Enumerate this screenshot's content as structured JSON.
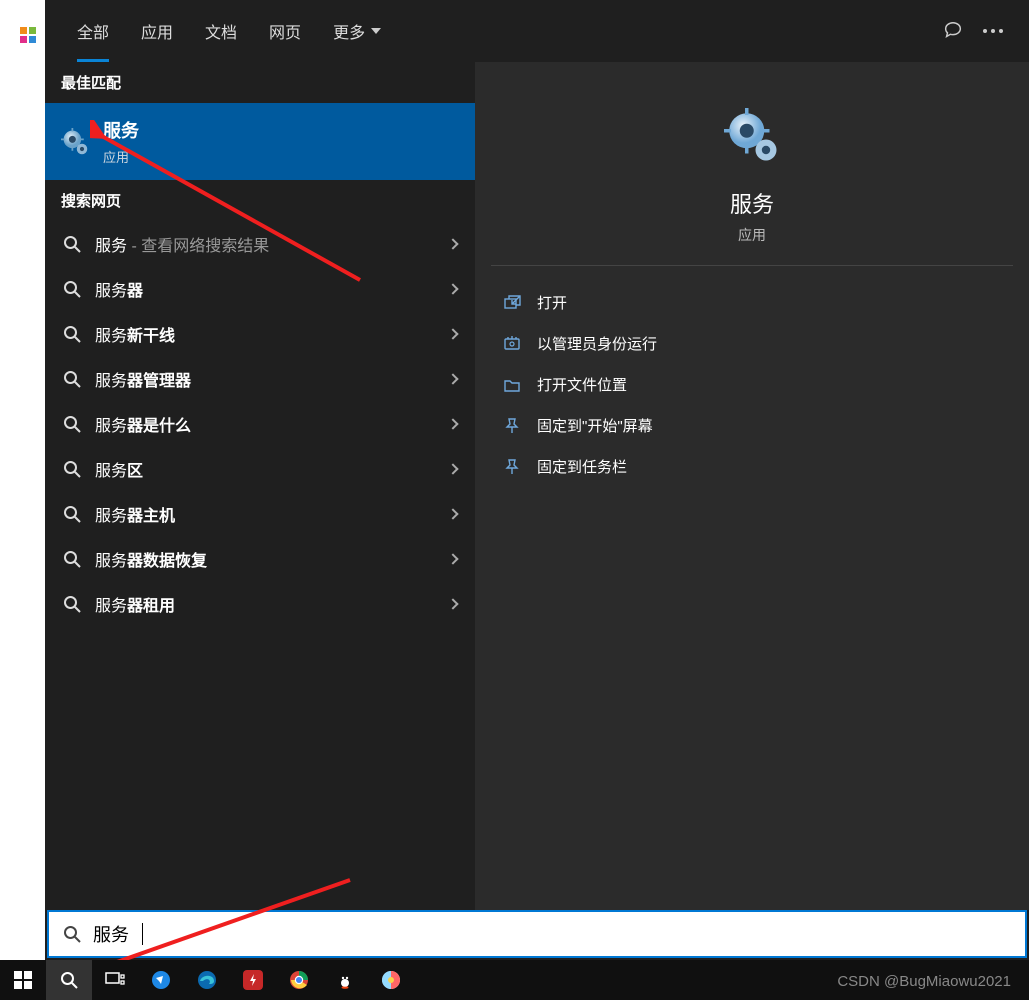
{
  "tabs": {
    "all": "全部",
    "apps": "应用",
    "docs": "文档",
    "web": "网页",
    "more": "更多"
  },
  "sections": {
    "best_match": "最佳匹配",
    "search_web": "搜索网页"
  },
  "best_match": {
    "title": "服务",
    "subtitle": "应用"
  },
  "suggestions": [
    {
      "prefix": "服务",
      "bold": "",
      "suffix": " - 查看网络搜索结果"
    },
    {
      "prefix": "服务",
      "bold": "器",
      "suffix": ""
    },
    {
      "prefix": "服务",
      "bold": "新干线",
      "suffix": ""
    },
    {
      "prefix": "服务",
      "bold": "器管理器",
      "suffix": ""
    },
    {
      "prefix": "服务",
      "bold": "器是什么",
      "suffix": ""
    },
    {
      "prefix": "服务",
      "bold": "区",
      "suffix": ""
    },
    {
      "prefix": "服务",
      "bold": "器主机",
      "suffix": ""
    },
    {
      "prefix": "服务",
      "bold": "器数据恢复",
      "suffix": ""
    },
    {
      "prefix": "服务",
      "bold": "器租用",
      "suffix": ""
    }
  ],
  "detail": {
    "title": "服务",
    "subtitle": "应用",
    "actions": {
      "open": "打开",
      "run_admin": "以管理员身份运行",
      "open_loc": "打开文件位置",
      "pin_start": "固定到\"开始\"屏幕",
      "pin_taskbar": "固定到任务栏"
    }
  },
  "search": {
    "query": "服务"
  },
  "watermark": "CSDN @BugMiaowu2021"
}
